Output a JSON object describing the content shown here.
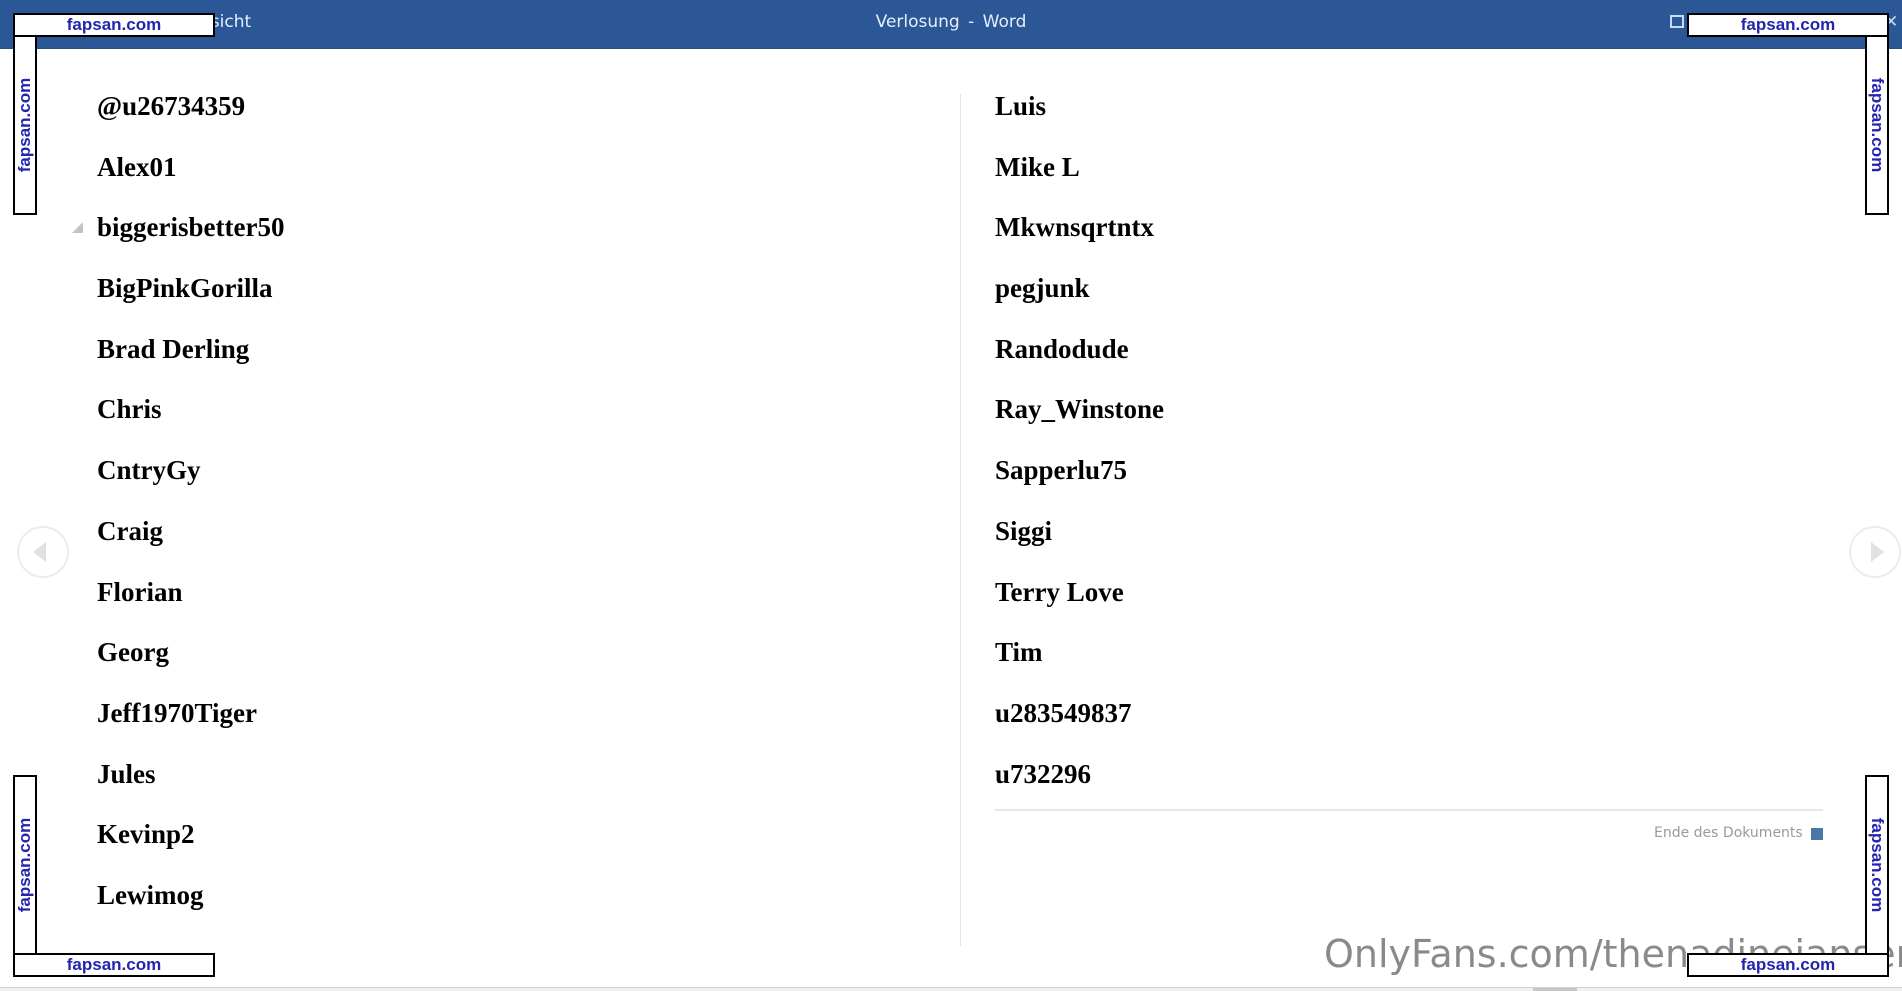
{
  "window": {
    "title_left_fragment": "nsicht",
    "title": "Verlosung  -  Word",
    "fullscreen_icon": "fullscreen-icon",
    "close_icon": "close-icon",
    "accent_color": "#2b5797"
  },
  "document": {
    "left_column": [
      "@u26734359",
      "Alex01",
      "biggerisbetter50",
      "BigPinkGorilla",
      "Brad Derling",
      "Chris",
      "CntryGy",
      "Craig",
      "Florian",
      "Georg",
      "Jeff1970Tiger",
      "Jules",
      "Kevinp2",
      "Lewimog"
    ],
    "right_column": [
      "Luis",
      "Mike L",
      "Mkwnsqrtntx",
      "pegjunk",
      "Randodude",
      "Ray_Winstone",
      "Sapperlu75",
      "Siggi",
      "Terry Love",
      "Tim",
      "u283549837",
      "u732296"
    ],
    "end_label": "Ende des Dokuments",
    "end_marker_color": "#4a76a8"
  },
  "navigation": {
    "prev_icon": "previous-page-icon",
    "next_icon": "next-page-icon"
  },
  "watermarks": {
    "corner_text": "fapsan.com",
    "onlyfans_text": "OnlyFans.com/thenadinejansen"
  }
}
